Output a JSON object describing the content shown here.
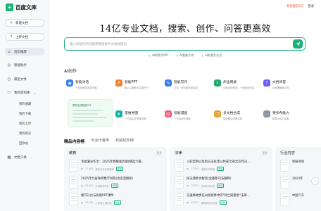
{
  "brand": {
    "logo_text": "百度文库"
  },
  "sidebar": {
    "new_doc": "新建文档",
    "upload_doc": "上传文档",
    "nav": [
      {
        "label": "首页推荐"
      },
      {
        "label": "智能助手"
      },
      {
        "label": "最近文件"
      },
      {
        "label": "我的资料库"
      }
    ],
    "library_sub": [
      "我的收藏",
      "我的下载",
      "我的上传",
      "我的购买",
      "回收站"
    ],
    "doc_tools": "文档工具"
  },
  "top": {
    "promo": "新客最低2元",
    "login": "登录"
  },
  "hero": {
    "headline": "14亿专业文档，搜索、创作、问答更高效",
    "search_placeholder": "输入你想问的问题或要搜索的文档关键词",
    "chips": [
      "AI帮我写PPT",
      "AI智能写作",
      "AI帮我写长文"
    ]
  },
  "ai": {
    "title": "AI创作",
    "preview_title": "帮你生成智能PPT",
    "cards": [
      {
        "name": "智能对话",
        "desc": "个性化解答各类问题",
        "color": "#2f7df6",
        "icon": "chat-icon"
      },
      {
        "name": "智能PPT",
        "desc": "输入主题即可生成PPT",
        "color": "#f2812e",
        "icon": "ppt-icon"
      },
      {
        "name": "智能写作",
        "desc": "文章、材料撰写更高效",
        "color": "#3a7bef",
        "icon": "write-icon"
      },
      {
        "name": "AI全网搜",
        "desc": "汇聚全网资源，一键整合信息",
        "color": "#22a86a",
        "icon": "search-icon"
      },
      {
        "name": "文档问答",
        "desc": "AI快速解读文档",
        "color": "#6a5cf0",
        "icon": "qa-icon"
      },
      {
        "name": "思维导图",
        "desc": "一句话生成思维导图",
        "color": "#14b1a2",
        "icon": "mindmap-icon"
      },
      {
        "name": "智能漫画",
        "desc": "一句话创作漫画",
        "color": "#f05a7a",
        "icon": "comic-icon"
      },
      {
        "name": "多文档合成",
        "desc": "智能融合多篇文档",
        "color": "#e0a12a",
        "icon": "merge-icon"
      },
      {
        "name": "更多AI能力",
        "desc": "更多AI能力探索",
        "color": "#8a94a6",
        "icon": "more-icon"
      }
    ]
  },
  "tabs": [
    "精品内容榜",
    "专业作者榜",
    "权威机构榜"
  ],
  "panels": [
    {
      "title": "教育",
      "more": "更多",
      "rows": [
        {
          "title": "幸福满分作文：2025年春晚观后感(精选六篇...",
          "meta": "17,403",
          "author": "教师文库优质推荐",
          "badge": "优选"
        },
        {
          "title": "2025年九省联考数学试卷(含答案解析)",
          "meta": "16,002",
          "author": "中考数学专栏",
          "badge": "优选"
        },
        {
          "title": "春节礼仪与民俗PPT课件",
          "meta": "14,188",
          "author": "小学语文课件馆",
          "badge": "优选"
        }
      ]
    },
    {
      "title": "法律",
      "more": "更多",
      "rows": [
        {
          "title": "入职案例以危险方法危害公共安全罪北京判决...",
          "meta": "17,403",
          "author": "法律文书精选",
          "badge": "优选"
        },
        {
          "title": "民法典条文解读(含最新司法解释)",
          "meta": "12,870",
          "author": "法学实务研究",
          "badge": "优选"
        },
        {
          "title": "交通事故责任纠纷案件中的\"死亡赔偿金\"法律...",
          "meta": "11,075",
          "author": "律师事务所文库",
          "badge": "优选"
        }
      ]
    },
    {
      "title": "行业内容",
      "more": "",
      "rows": [
        {
          "title": "智研咨询",
          "meta": "",
          "author": "",
          "badge": ""
        },
        {
          "title": "2024年",
          "meta": "",
          "author": "",
          "badge": ""
        },
        {
          "title": "中国汽车",
          "meta": "",
          "author": "",
          "badge": ""
        }
      ]
    }
  ]
}
